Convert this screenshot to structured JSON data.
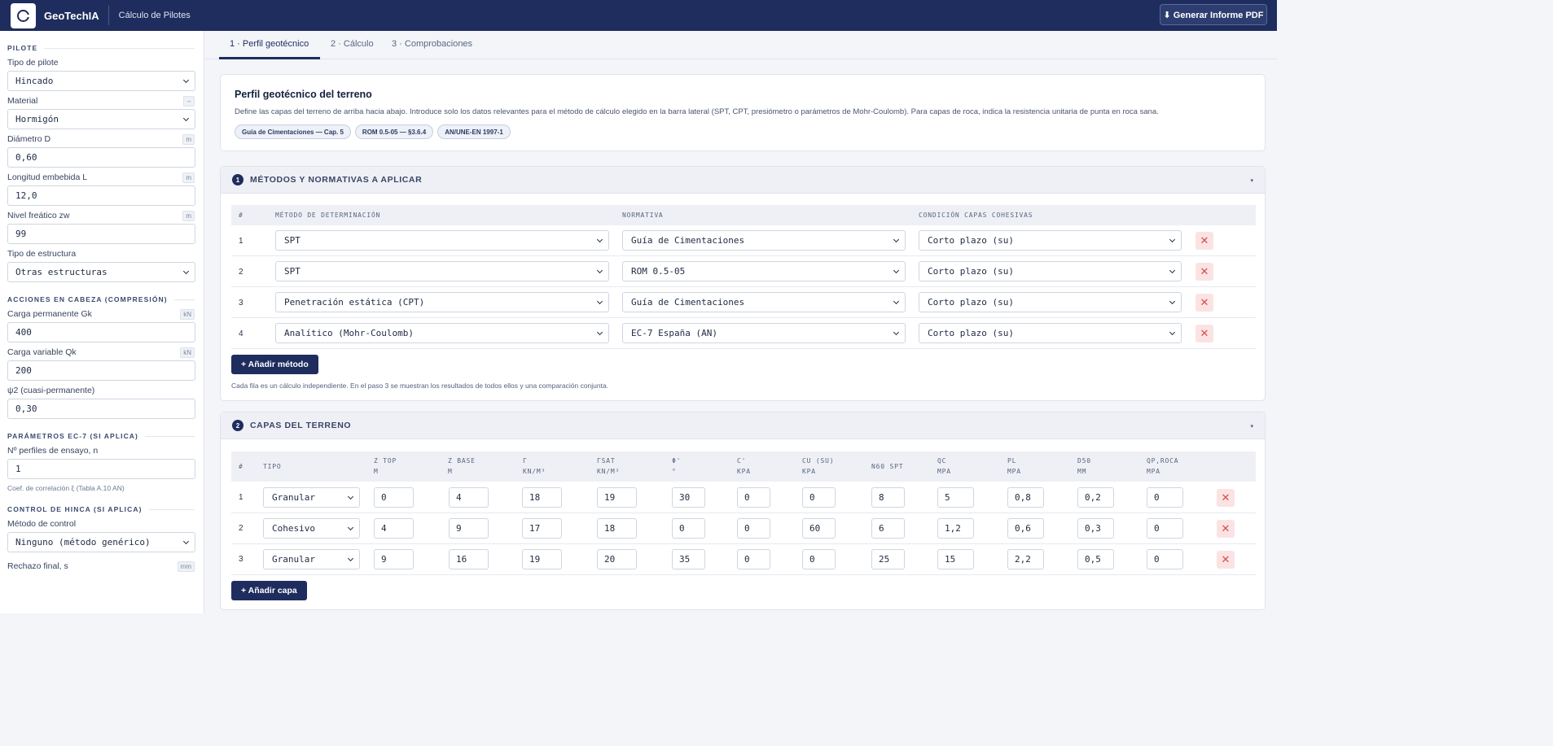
{
  "topbar": {
    "brand": "GeoTechIA",
    "subtitle": "Cálculo de Pilotes",
    "pdf_button": "⬇ Generar Informe PDF"
  },
  "sidebar": {
    "pilote_section": "PILOTE",
    "tipo_pilote": {
      "label": "Tipo de pilote",
      "value": "Hincado"
    },
    "material": {
      "label": "Material",
      "unit": "–",
      "value": "Hormigón"
    },
    "diametro": {
      "label": "Diámetro D",
      "unit": "m",
      "value": "0,60"
    },
    "longitud": {
      "label": "Longitud embebida L",
      "unit": "m",
      "value": "12,0"
    },
    "freatico": {
      "label": "Nivel freático zw",
      "unit": "m",
      "value": "99"
    },
    "estructura": {
      "label": "Tipo de estructura",
      "value": "Otras estructuras"
    },
    "acciones_section": "ACCIONES EN CABEZA (COMPRESIÓN)",
    "gk": {
      "label": "Carga permanente Gk",
      "unit": "kN",
      "value": "400"
    },
    "qk": {
      "label": "Carga variable Qk",
      "unit": "kN",
      "value": "200"
    },
    "psi2": {
      "label": "ψ2 (cuasi-permanente)",
      "value": "0,30"
    },
    "ec7_section": "PARÁMETROS EC-7 (SI APLICA)",
    "perfiles": {
      "label": "Nº perfiles de ensayo, n",
      "value": "1"
    },
    "hint": "Coef. de correlación ξ (Tabla A.10 AN)",
    "hinca_section": "CONTROL DE HINCA (SI APLICA)",
    "metodo_control": {
      "label": "Método de control",
      "value": "Ninguno (método genérico)"
    },
    "rechazo": {
      "label": "Rechazo final, s",
      "unit": "mm"
    }
  },
  "tabs": [
    "1 · Perfil geotécnico",
    "2 · Cálculo",
    "3 · Comprobaciones"
  ],
  "intro": {
    "title": "Perfil geotécnico del terreno",
    "description": "Define las capas del terreno de arriba hacia abajo. Introduce solo los datos relevantes para el método de cálculo elegido en la barra lateral (SPT, CPT, presiómetro o parámetros de Mohr-Coulomb). Para capas de roca, indica la resistencia unitaria de punta en roca sana.",
    "chips": [
      "Guía de Cimentaciones — Cap. 5",
      "ROM 0.5-05 — §3.6.4",
      "AN/UNE-EN 1997-1"
    ]
  },
  "methods": {
    "number": "1",
    "title": "MÉTODOS Y NORMATIVAS A APLICAR",
    "caret": "▾",
    "headers": [
      "#",
      "MÉTODO DE DETERMINACIÓN",
      "NORMATIVA",
      "CONDICIÓN CAPAS COHESIVAS"
    ],
    "rows": [
      {
        "n": "1",
        "metodo": "SPT",
        "normativa": "Guía de Cimentaciones",
        "condicion": "Corto plazo (su)"
      },
      {
        "n": "2",
        "metodo": "SPT",
        "normativa": "ROM 0.5-05",
        "condicion": "Corto plazo (su)"
      },
      {
        "n": "3",
        "metodo": "Penetración estática (CPT)",
        "normativa": "Guía de Cimentaciones",
        "condicion": "Corto plazo (su)"
      },
      {
        "n": "4",
        "metodo": "Analítico (Mohr-Coulomb)",
        "normativa": "EC-7 España (AN)",
        "condicion": "Corto plazo (su)"
      }
    ],
    "add_button": "+ Añadir método",
    "note": "Cada fila es un cálculo independiente. En el paso 3 se muestran los resultados de todos ellos y una comparación conjunta.",
    "delete_symbol": "✕"
  },
  "layers": {
    "number": "2",
    "title": "CAPAS DEL TERRENO",
    "caret": "▾",
    "headers": [
      {
        "name": "#",
        "unit": ""
      },
      {
        "name": "TIPO",
        "unit": ""
      },
      {
        "name": "Z TOP",
        "unit": "M"
      },
      {
        "name": "Z BASE",
        "unit": "M"
      },
      {
        "name": "Γ",
        "unit": "KN/M³"
      },
      {
        "name": "ΓSAT",
        "unit": "KN/M³"
      },
      {
        "name": "Φ'",
        "unit": "°"
      },
      {
        "name": "C'",
        "unit": "KPA"
      },
      {
        "name": "CU (SU)",
        "unit": "KPA"
      },
      {
        "name": "N60 SPT",
        "unit": ""
      },
      {
        "name": "QC",
        "unit": "MPA"
      },
      {
        "name": "PL",
        "unit": "MPA"
      },
      {
        "name": "D50",
        "unit": "MM"
      },
      {
        "name": "QP,ROCA",
        "unit": "MPA"
      }
    ],
    "rows": [
      {
        "n": "1",
        "tipo": "Granular",
        "values": [
          "0",
          "4",
          "18",
          "19",
          "30",
          "0",
          "0",
          "8",
          "5",
          "0,8",
          "0,2",
          "0"
        ]
      },
      {
        "n": "2",
        "tipo": "Cohesivo",
        "values": [
          "4",
          "9",
          "17",
          "18",
          "0",
          "0",
          "60",
          "6",
          "1,2",
          "0,6",
          "0,3",
          "0"
        ]
      },
      {
        "n": "3",
        "tipo": "Granular",
        "values": [
          "9",
          "16",
          "19",
          "20",
          "35",
          "0",
          "0",
          "25",
          "15",
          "2,2",
          "0,5",
          "0"
        ]
      }
    ],
    "add_button": "+ Añadir capa",
    "delete_symbol": "✕"
  }
}
